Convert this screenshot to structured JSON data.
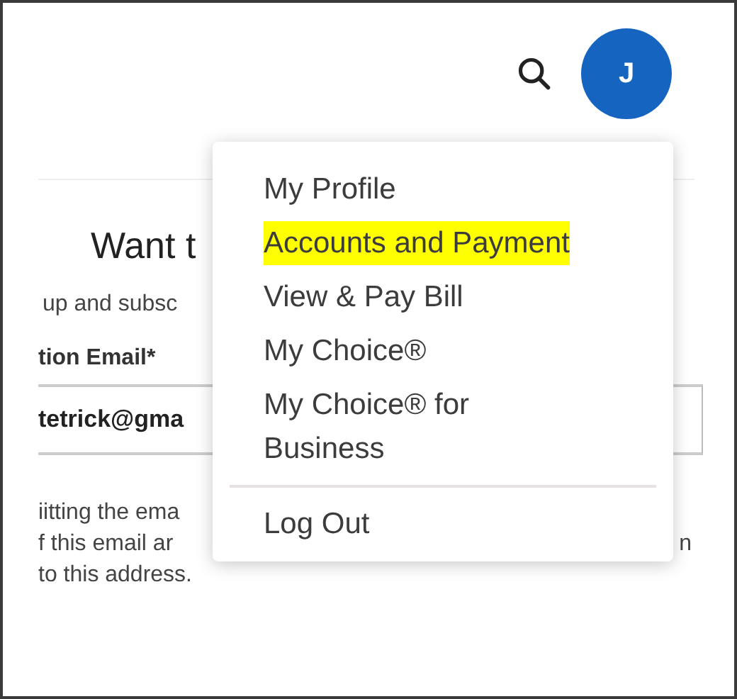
{
  "header": {
    "avatar": {
      "initial": "J"
    }
  },
  "background": {
    "heading": "Want t",
    "intro": "up and subsc",
    "field_label": "tion Email*",
    "field_value": "tetrick@gma",
    "notice_lines": [
      "iitting the ema",
      "f this email ar",
      "to this address."
    ],
    "notice_right": "n"
  },
  "menu": {
    "items": [
      {
        "label": "My Profile",
        "highlighted": false
      },
      {
        "label": "Accounts and Payment",
        "highlighted": true
      },
      {
        "label": "View & Pay Bill",
        "highlighted": false
      },
      {
        "label": "My Choice®",
        "highlighted": false
      },
      {
        "label": "My Choice® for Business",
        "highlighted": false
      }
    ],
    "footer_items": [
      {
        "label": "Log Out",
        "highlighted": false
      }
    ]
  }
}
